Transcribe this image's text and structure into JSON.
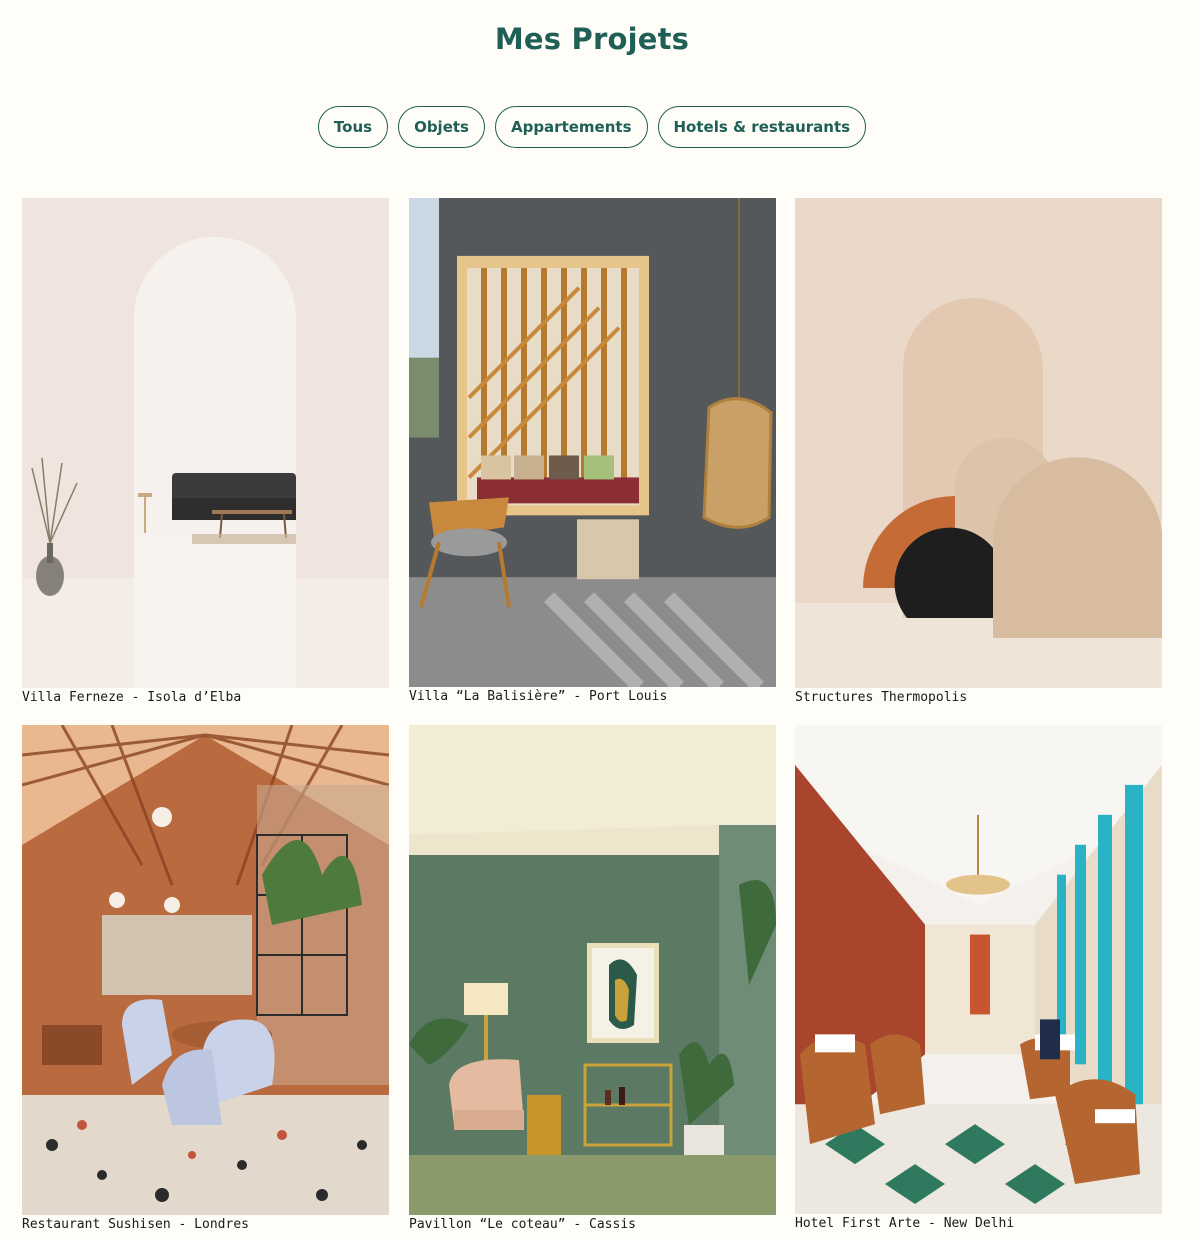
{
  "header": {
    "title": "Mes Projets"
  },
  "filters": [
    {
      "label": "Tous"
    },
    {
      "label": "Objets"
    },
    {
      "label": "Appartements"
    },
    {
      "label": "Hotels & restaurants"
    }
  ],
  "colors": {
    "accent": "#1f5f55",
    "background": "#fefdf8"
  },
  "projects": [
    {
      "caption": "Villa Ferneze - Isola d’Elba"
    },
    {
      "caption": "Villa “La Balisière” - Port Louis"
    },
    {
      "caption": "Structures Thermopolis"
    },
    {
      "caption": "Restaurant Sushisen - Londres"
    },
    {
      "caption": "Pavillon “Le coteau” - Cassis"
    },
    {
      "caption": "Hotel First Arte - New Delhi"
    }
  ]
}
